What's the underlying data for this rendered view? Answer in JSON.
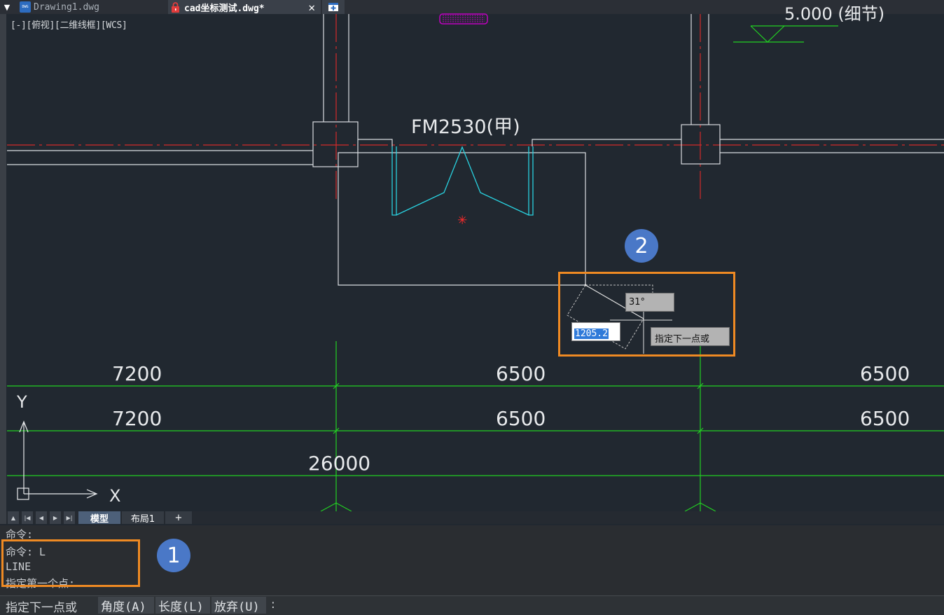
{
  "tabs": {
    "menu_glyph": "▼",
    "tab1_label": "Drawing1.dwg",
    "tab1_icon_text": "DWG",
    "tab2_label": "cad坐标测试.dwg*",
    "close_glyph": "✕",
    "new_tab_glyph": "+"
  },
  "viewport": {
    "label": "[-][俯视][二维线框][WCS]"
  },
  "drawing": {
    "door_label": "FM2530(甲)",
    "elevation_partial": "5.000 (细节)",
    "dim_row1": [
      "7200",
      "6500",
      "6500"
    ],
    "dim_row2": [
      "7200",
      "6500",
      "6500"
    ],
    "dim_total": "26000",
    "ucs_x": "X",
    "ucs_y": "Y",
    "colors": {
      "background": "#212830",
      "wall": "#d9dde1",
      "axis_red": "#d42a2a",
      "dimension_green": "#22d022",
      "door_cyan": "#29d2e0",
      "hatch_magenta": "#c000c0"
    }
  },
  "dynamic_input": {
    "angle": "31°",
    "length": "1205.2",
    "prompt": "指定下一点或"
  },
  "annotations": {
    "badge1": "1",
    "badge2": "2",
    "highlight_color": "#ef8a23"
  },
  "layout_tabs": {
    "model": "模型",
    "layout1": "布局1",
    "add": "+"
  },
  "command_history": [
    "命令:",
    "命令: L",
    "LINE",
    "指定第一个点:"
  ],
  "command_line": {
    "prompt": "指定下一点或",
    "options": [
      "角度(A)",
      "长度(L)",
      "放弃(U)"
    ],
    "colon": ":"
  }
}
